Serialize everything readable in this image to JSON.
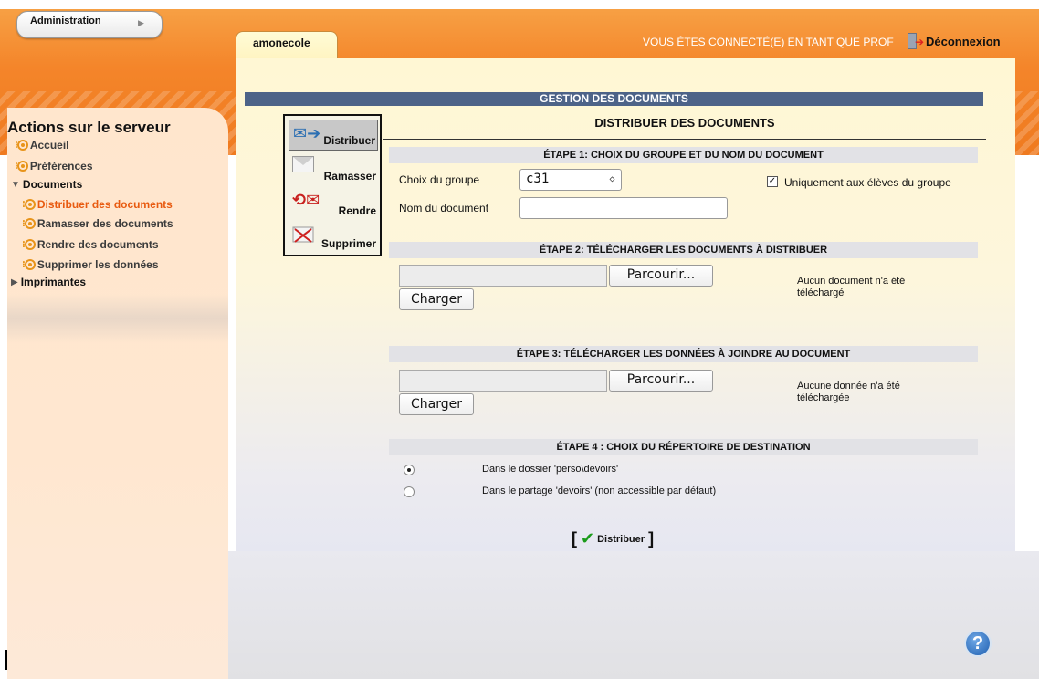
{
  "topbar": {
    "admin_label": "Administration",
    "tab_label": "amonecole",
    "logged_in_text": "VOUS ÊTES CONNECTÉ(E) EN TANT QUE PROF",
    "logout_label": "Déconnexion"
  },
  "sidebar": {
    "title": "Actions sur le serveur",
    "items": [
      {
        "label": "Accueil"
      },
      {
        "label": "Préférences"
      },
      {
        "label": "Documents"
      },
      {
        "label": "Distribuer des documents"
      },
      {
        "label": "Ramasser des documents"
      },
      {
        "label": "Rendre des documents"
      },
      {
        "label": "Supprimer les données"
      },
      {
        "label": "Imprimantes"
      }
    ]
  },
  "main": {
    "header": "GESTION DES DOCUMENTS",
    "section_title": "DISTRIBUER DES DOCUMENTS",
    "menu": [
      "Distribuer",
      "Ramasser",
      "Rendre",
      "Supprimer"
    ],
    "step1": {
      "title": "ÉTAPE 1: CHOIX DU GROUPE ET DU NOM DU DOCUMENT",
      "group_label": "Choix du groupe",
      "group_value": "c31",
      "only_group_label": "Uniquement aux élèves du groupe",
      "only_group_checked": true,
      "doc_name_label": "Nom du document",
      "doc_name_value": ""
    },
    "step2": {
      "title": "ÉTAPE 2: TÉLÉCHARGER LES DOCUMENTS À DISTRIBUER",
      "browse_label": "Parcourir...",
      "load_label": "Charger",
      "status": "Aucun document n'a été téléchargé"
    },
    "step3": {
      "title": "ÉTAPE 3: TÉLÉCHARGER LES DONNÉES À JOINDRE AU DOCUMENT",
      "browse_label": "Parcourir...",
      "load_label": "Charger",
      "status": "Aucune donnée n'a été téléchargée"
    },
    "step4": {
      "title": "ÉTAPE 4 : CHOIX DU RÉPERTOIRE DE DESTINATION",
      "options": [
        {
          "label": "Dans le dossier 'perso\\devoirs'",
          "selected": true
        },
        {
          "label": "Dans le partage 'devoirs' (non accessible par défaut)",
          "selected": false
        }
      ]
    },
    "submit_label": "Distribuer"
  },
  "icons": {
    "help": "help-icon",
    "logout": "logout-icon"
  },
  "colors": {
    "topbar": "#f4852a",
    "header_bar": "#4d6388",
    "active_nav": "#e85a10"
  }
}
